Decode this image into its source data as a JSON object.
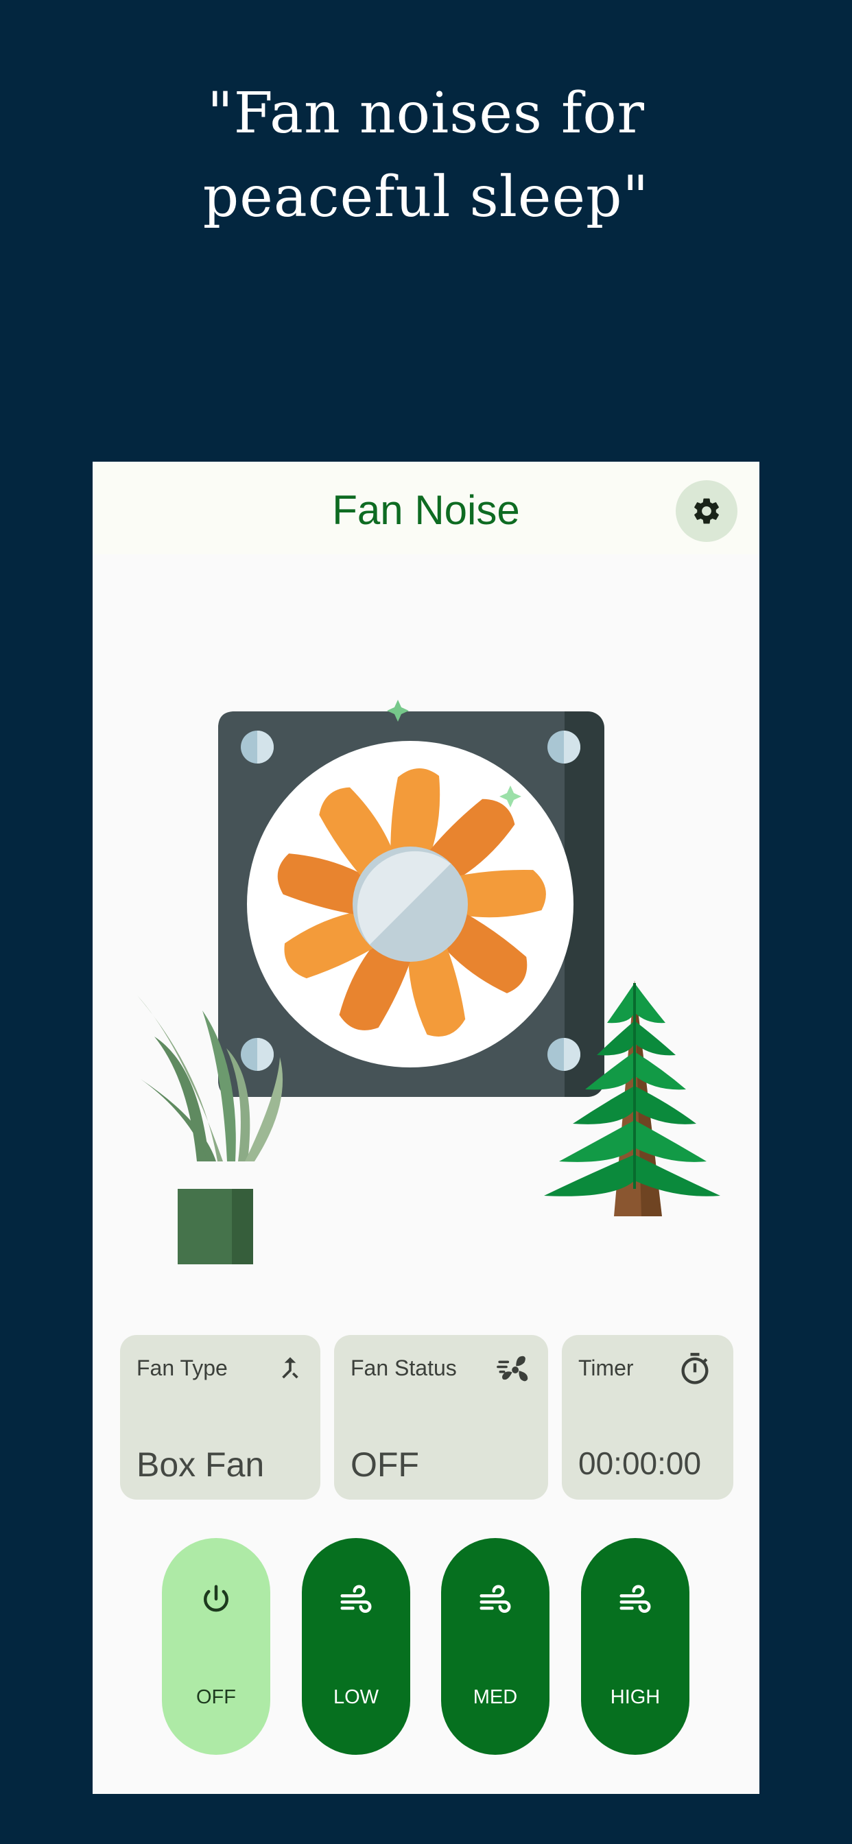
{
  "tagline": {
    "line1": "\"Fan noises for",
    "line2": "peaceful sleep\""
  },
  "app": {
    "title": "Fan Noise",
    "settings_icon": "gear-icon"
  },
  "cards": [
    {
      "label": "Fan Type",
      "value": "Box Fan",
      "icon": "merge-arrow-icon"
    },
    {
      "label": "Fan Status",
      "value": "OFF",
      "icon": "fan-icon"
    },
    {
      "label": "Timer",
      "value": "00:00:00",
      "icon": "timer-icon"
    }
  ],
  "speeds": [
    {
      "label": "OFF",
      "icon": "power-icon",
      "selected": true
    },
    {
      "label": "LOW",
      "icon": "wind-icon",
      "selected": false
    },
    {
      "label": "MED",
      "icon": "wind-icon",
      "selected": false
    },
    {
      "label": "HIGH",
      "icon": "wind-icon",
      "selected": false
    }
  ],
  "colors": {
    "background": "#03263f",
    "brand_green": "#0e6b22",
    "button_green": "#06701f",
    "button_selected": "#aeeaa6",
    "card": "#dfe4d9",
    "fan_blade": "#f9a03f"
  }
}
